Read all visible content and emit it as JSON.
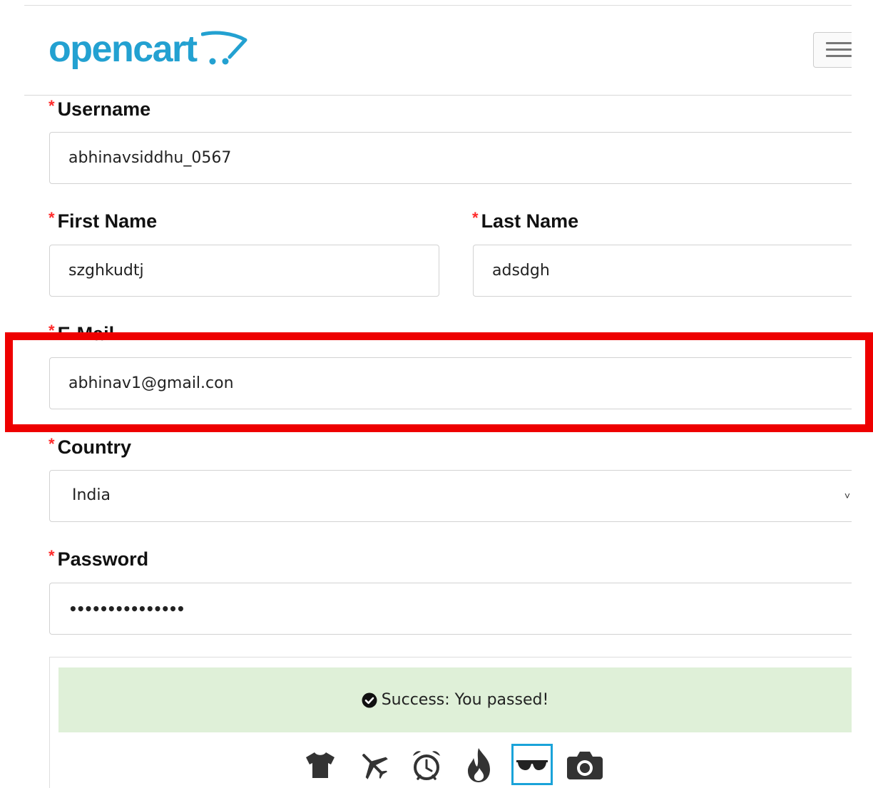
{
  "header": {
    "logo_text": "opencart",
    "menu_icon": "hamburger-icon"
  },
  "form": {
    "username": {
      "label": "Username",
      "value": "abhinavsiddhu_0567",
      "required": true
    },
    "first_name": {
      "label": "First Name",
      "value": "szghkudtj",
      "required": true
    },
    "last_name": {
      "label": "Last Name",
      "value": "adsdgh",
      "required": true
    },
    "email": {
      "label": "E-Mail",
      "value": "abhinav1@gmail.con",
      "required": true
    },
    "country": {
      "label": "Country",
      "selected": "India",
      "required": true
    },
    "password": {
      "label": "Password",
      "masked_value": "•••••••••••••••",
      "required": true
    },
    "required_marker": "*"
  },
  "captcha": {
    "success_message": "Success: You passed!",
    "icons": [
      "tshirt-icon",
      "airplane-icon",
      "alarm-clock-icon",
      "fire-icon",
      "sunglasses-icon",
      "camera-icon"
    ],
    "selected_icon": "sunglasses-icon"
  },
  "colors": {
    "brand": "#23a1d1",
    "required": "#ff2a2a",
    "highlight": "#ee0000",
    "success_bg": "#dff0d8",
    "selected_border": "#1aa3d9"
  }
}
